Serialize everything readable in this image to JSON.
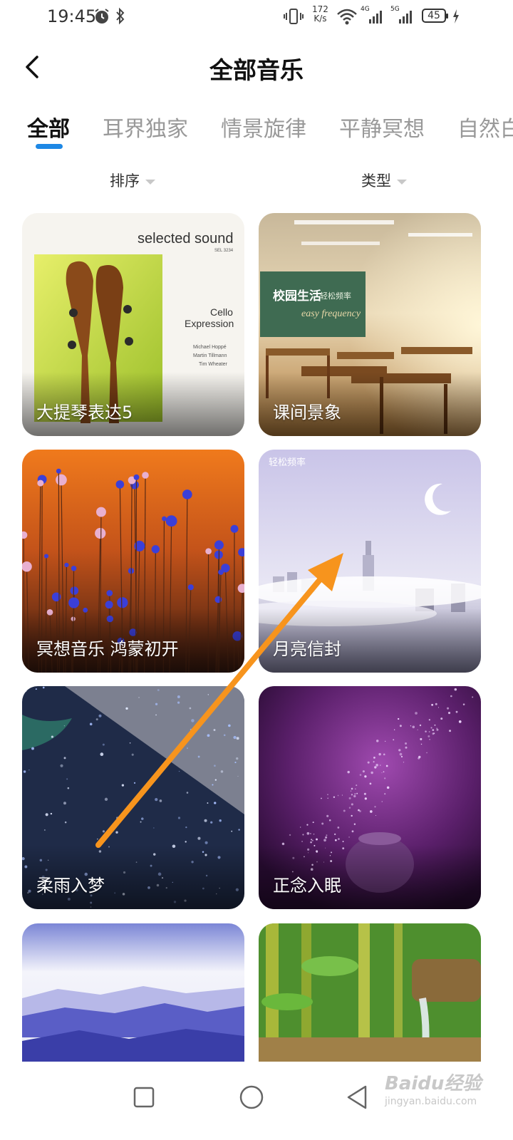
{
  "status_bar": {
    "time": "19:45",
    "net_speed_value": "172",
    "net_speed_unit": "K/s",
    "signal_1": "4G",
    "signal_2": "5G",
    "battery": "45"
  },
  "header": {
    "title": "全部音乐"
  },
  "tabs": [
    {
      "label": "全部"
    },
    {
      "label": "耳界独家"
    },
    {
      "label": "情景旋律"
    },
    {
      "label": "平静冥想"
    },
    {
      "label": "自然白噪"
    }
  ],
  "filters": {
    "sort_label": "排序",
    "type_label": "类型"
  },
  "cards": [
    {
      "title": "大提琴表达5",
      "art_text": [
        "selected sound",
        "SEL 3234",
        "Cello",
        "Expression",
        "Michael Hoppé",
        "Martin Tillmann",
        "Tim Wheater"
      ]
    },
    {
      "title": "课间景象",
      "art_text": [
        "校园生活",
        "轻松频率",
        "easy frequency"
      ]
    },
    {
      "title": "冥想音乐 鸿蒙初开"
    },
    {
      "title": "月亮信封",
      "art_text": [
        "轻松频率"
      ]
    },
    {
      "title": "柔雨入梦"
    },
    {
      "title": "正念入眠"
    },
    {
      "title": ""
    },
    {
      "title": ""
    }
  ],
  "watermark": {
    "brand": "Baidu经验",
    "url": "jingyan.baidu.com"
  },
  "colors": {
    "accent": "#1e88e5",
    "annotation_arrow": "#f7941d"
  }
}
